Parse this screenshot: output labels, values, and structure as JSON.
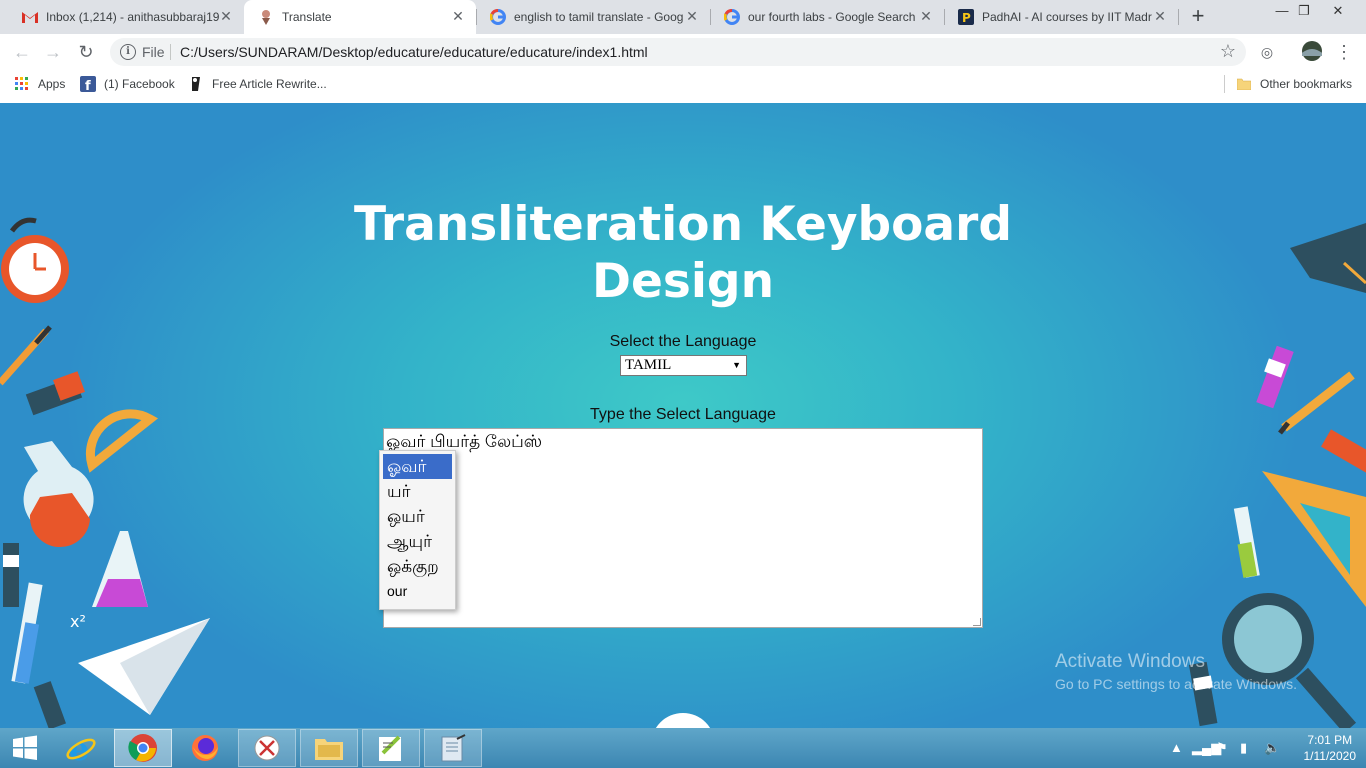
{
  "browser": {
    "tabs": [
      {
        "title": "Inbox (1,214) - anithasubbaraj19",
        "icon": "gmail-icon",
        "active": false
      },
      {
        "title": "Translate",
        "icon": "page-favicon",
        "active": true
      },
      {
        "title": "english to tamil translate - Goog",
        "icon": "google-icon",
        "active": false
      },
      {
        "title": "our fourth labs - Google Search",
        "icon": "google-icon",
        "active": false
      },
      {
        "title": "PadhAI - AI courses by IIT Madr",
        "icon": "padhai-icon",
        "active": false
      }
    ],
    "address": {
      "scheme_label": "File",
      "url": "C:/Users/SUNDARAM/Desktop/educature/educature/educature/index1.html"
    },
    "bookmarks": [
      {
        "label": "Apps",
        "icon": "apps-grid-icon"
      },
      {
        "label": "(1) Facebook",
        "icon": "facebook-icon"
      },
      {
        "label": "Free Article Rewrite...",
        "icon": "article-icon"
      }
    ],
    "other_bookmarks": "Other bookmarks"
  },
  "page": {
    "title": "Transliteration Keyboard Design",
    "select_label": "Select the Language",
    "language_select": {
      "selected": "TAMIL"
    },
    "type_label": "Type the Select Language",
    "textarea_value": "ஓவர் பியர்த் லேப்ஸ்",
    "suggestions": [
      {
        "text": "ஓவர்",
        "highlighted": true
      },
      {
        "text": "யர்",
        "highlighted": false
      },
      {
        "text": "ஒயர்",
        "highlighted": false
      },
      {
        "text": "ஆயுர்",
        "highlighted": false
      },
      {
        "text": "ஒக்குற",
        "highlighted": false
      },
      {
        "text": "our",
        "highlighted": false
      }
    ]
  },
  "watermark": {
    "line1": "Activate Windows",
    "line2": "Go to PC settings to activate Windows."
  },
  "taskbar": {
    "apps": [
      "start-icon",
      "internet-explorer-icon",
      "chrome-icon",
      "firefox-icon",
      "snipping-tool-icon",
      "file-explorer-icon",
      "notepad-plus-icon",
      "notepad-icon"
    ],
    "time": "7:01 PM",
    "date": "1/11/2020"
  },
  "colors": {
    "highlight": "#3a6cc9",
    "page_bg": "#33b3c9",
    "taskbar": "#4a95bf"
  }
}
